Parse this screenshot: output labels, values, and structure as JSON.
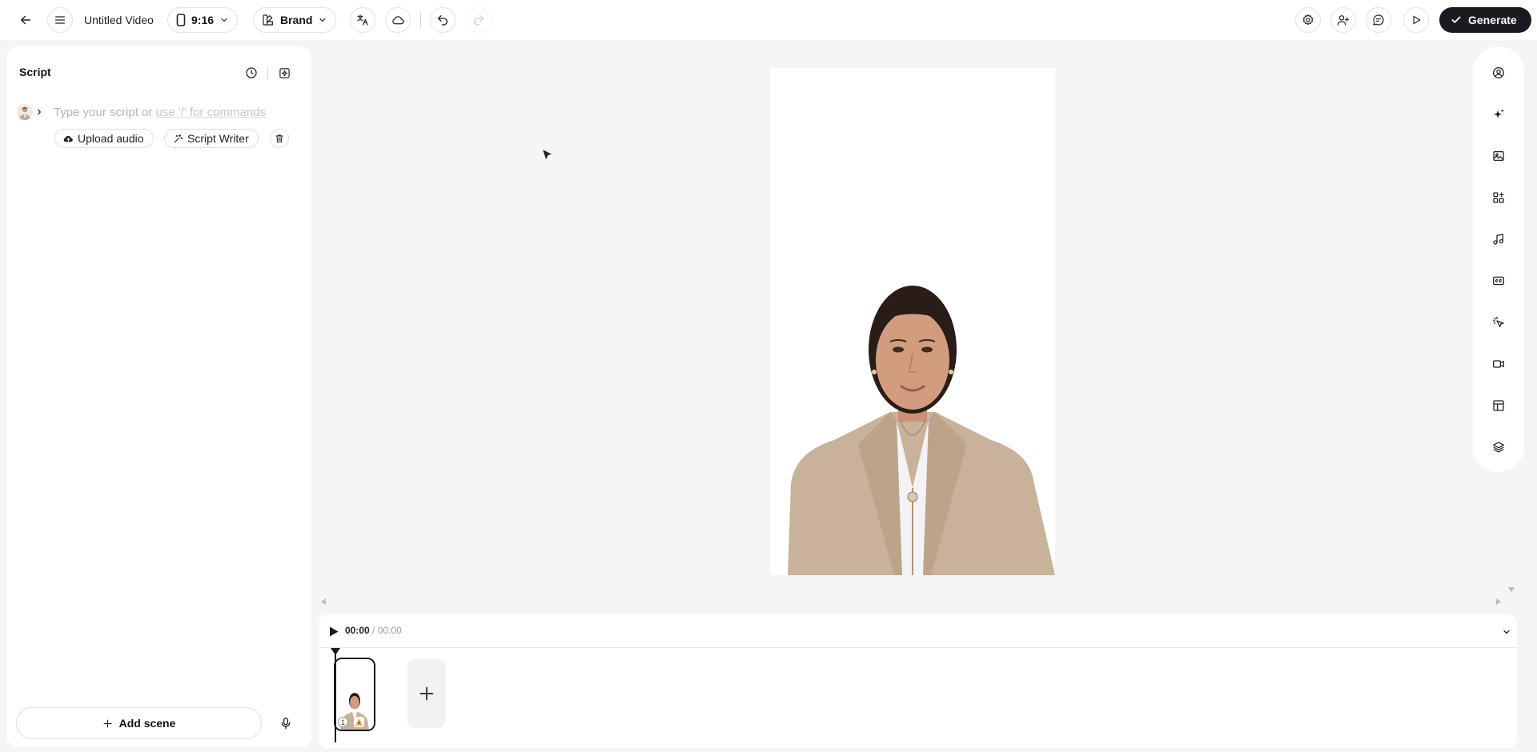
{
  "topbar": {
    "title": "Untitled Video",
    "aspect_ratio": "9:16",
    "brand_label": "Brand",
    "generate_label": "Generate"
  },
  "script_panel": {
    "title": "Script",
    "placeholder_main": "Type your script or",
    "placeholder_cmd": "use '/' for commands",
    "upload_audio_label": "Upload audio",
    "script_writer_label": "Script Writer",
    "add_scene_label": "Add scene"
  },
  "timeline": {
    "current_time": "00:00",
    "separator": "/",
    "total_time": "00:00",
    "scene_number": "1"
  },
  "colors": {
    "accent_dark": "#1b1b1f",
    "panel_bg": "#ffffff",
    "app_bg": "#f4f5f7",
    "jacket": "#c9b29a",
    "skin": "#d19d7e",
    "hair": "#2a1c16"
  }
}
